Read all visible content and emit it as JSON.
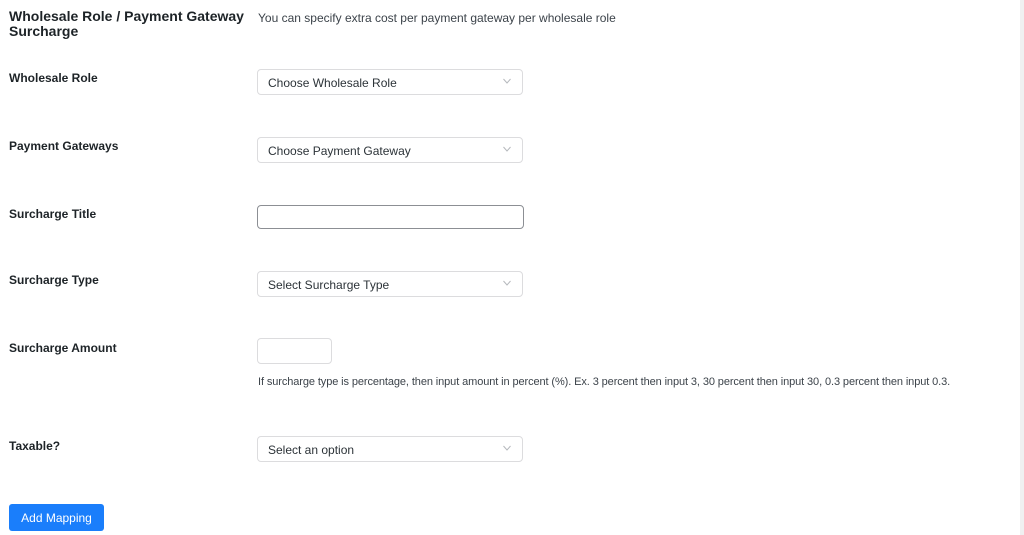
{
  "section": {
    "title": "Wholesale Role / Payment Gateway Surcharge",
    "description": "You can specify extra cost per payment gateway per wholesale role"
  },
  "fields": {
    "wholesale_role": {
      "label": "Wholesale Role",
      "selected": "Choose Wholesale Role",
      "icon": "chevron-down-icon"
    },
    "payment_gateways": {
      "label": "Payment Gateways",
      "selected": "Choose Payment Gateway",
      "icon": "chevron-down-icon"
    },
    "surcharge_title": {
      "label": "Surcharge Title",
      "value": "",
      "placeholder": ""
    },
    "surcharge_type": {
      "label": "Surcharge Type",
      "selected": "Select Surcharge Type",
      "icon": "chevron-down-icon"
    },
    "surcharge_amount": {
      "label": "Surcharge Amount",
      "value": "",
      "placeholder": "",
      "help": "If surcharge type is percentage, then input amount in percent (%). Ex. 3 percent then input 3, 30 percent then input 30, 0.3 percent then input 0.3."
    },
    "taxable": {
      "label": "Taxable?",
      "selected": "Select an option",
      "icon": "chevron-down-icon"
    }
  },
  "actions": {
    "add_mapping_label": "Add Mapping"
  },
  "colors": {
    "primary": "#1a7efb",
    "label_text": "#1d2327",
    "border": "#dcdcde"
  }
}
